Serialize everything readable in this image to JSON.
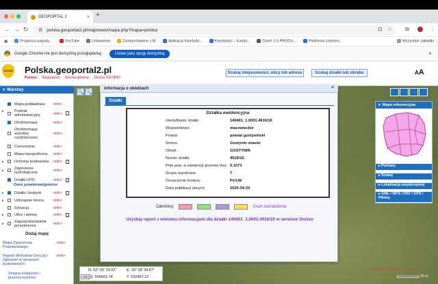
{
  "browser": {
    "tab_title": "GEOPORTAL 2",
    "new_tab": "+",
    "url": "polska.geoportal2.pl/map/www/mapa.php?mapa=polska",
    "bookmarks": [
      "Prognoza pogody...",
      "YouTube",
      "Ustawienia",
      "Zaimportowane z IE",
      "Aplikacja Kandyda...",
      "Kandydaci – Kandy...",
      "Dzień 1-5 PRODU...",
      "Platforma szkoleni..."
    ],
    "bookmarks_all": "Wszystkie zakładki",
    "default_bar_text": "Google Chrome nie jest domyślną przeglądarką",
    "default_bar_button": "Ustaw jako opcję domyślną"
  },
  "portal": {
    "logo_text": "GEOBID",
    "title": "Polska.geoportal2.pl",
    "links": [
      "Pomoc",
      "Regulamin",
      "Strona główna",
      "Strona GEOBID"
    ],
    "search_address_btn": "Szukaj miejscowości, ulicy lub adresu",
    "search_parcel_btn": "Szukaj działki lub obrębu",
    "font_size_label": "AA"
  },
  "layers": {
    "header": "Warstwy",
    "info_label": "<info>",
    "items": [
      {
        "name": "Mapa podkładowa",
        "checked": true
      },
      {
        "name": "Podział administracyjny",
        "checked": false
      },
      {
        "name": "Ortofotomapa",
        "checked": true
      },
      {
        "name": "Ortofotomapa wysokiej rozdzielczości",
        "checked": false
      },
      {
        "name": "Cieniowanie",
        "checked": false
      },
      {
        "name": "Mapa topograficzna",
        "checked": false
      },
      {
        "name": "Ochrona środowiska",
        "checked": false
      },
      {
        "name": "Zagrożenia hydrologiczne",
        "checked": false
      },
      {
        "name": "Działki LPIS",
        "checked": true
      }
    ],
    "section_title": "Dane powiatowe/gminne",
    "items2": [
      {
        "name": "Działki i budynki",
        "checked": true
      },
      {
        "name": "Uzbrojenie terenu",
        "checked": false
      },
      {
        "name": "Sytuacja",
        "checked": false
      },
      {
        "name": "Ulice i adresy",
        "checked": false
      },
      {
        "name": "Zagospodarowanie przestrzenne",
        "checked": false
      }
    ],
    "add_map": "Dodaj mapę",
    "extra": [
      "Mapa Zagrożenia Powodziowego",
      "Rejestr Wniosków Decyzji i Zgłoszeń w sprawach budowlanych",
      "Zmiana kolejności i przezroczystości"
    ]
  },
  "dialog": {
    "title": "Informacja o obiektach",
    "close": "×",
    "tab": "Działki",
    "table_title": "Działka ewidencyjna",
    "rows": [
      {
        "k": "Identyfikator działki",
        "v": "140401_1.0001.4916/16"
      },
      {
        "k": "Województwo",
        "v": "mazowieckie"
      },
      {
        "k": "Powiat",
        "v": "powiat gostyniński"
      },
      {
        "k": "Gmina",
        "v": "Gostynin miasto"
      },
      {
        "k": "Obręb",
        "v": "GOSTYNIN"
      },
      {
        "k": "Numer działki",
        "v": "4916/16"
      },
      {
        "k": "Pole pow. w ewidencji gruntów (ha)",
        "v": "0.1073"
      },
      {
        "k": "Grupa rejestrowa",
        "v": "7"
      },
      {
        "k": "Oznaczenie konturu",
        "v": "PsV,W"
      },
      {
        "k": "Data publikacji danych",
        "v": "2025-04-20"
      }
    ],
    "zakoloruj": "Zakoloruj:",
    "swatches": [
      "#f59ab3",
      "#8ee27a",
      "#a89be6",
      "#ffe04a"
    ],
    "clear": "Usuń zaznaczenia",
    "report_prefix": "Uzyskaj raport z wieloma informacjami dla działki ",
    "report_id": "140401_1.0001.4916/16",
    "report_suffix": " w serwisie OnGeo"
  },
  "right_panel": {
    "header": "Mapa referencyjna",
    "items": [
      "Pomiary",
      "Szukaj",
      "Lokalizacja współrzędnej",
      "GML / WFS / DXF / GPX / Pikiety"
    ]
  },
  "coords": {
    "n": "N: 52° 25' 29.62\"",
    "e": "E: 19° 28' 38.87\"",
    "epsg": "1992",
    "x": "X: 506661.74",
    "y": "Y: 532457.12"
  },
  "scale": {
    "label": "20 m"
  },
  "attribution": "© OpenStreetMap contributors"
}
